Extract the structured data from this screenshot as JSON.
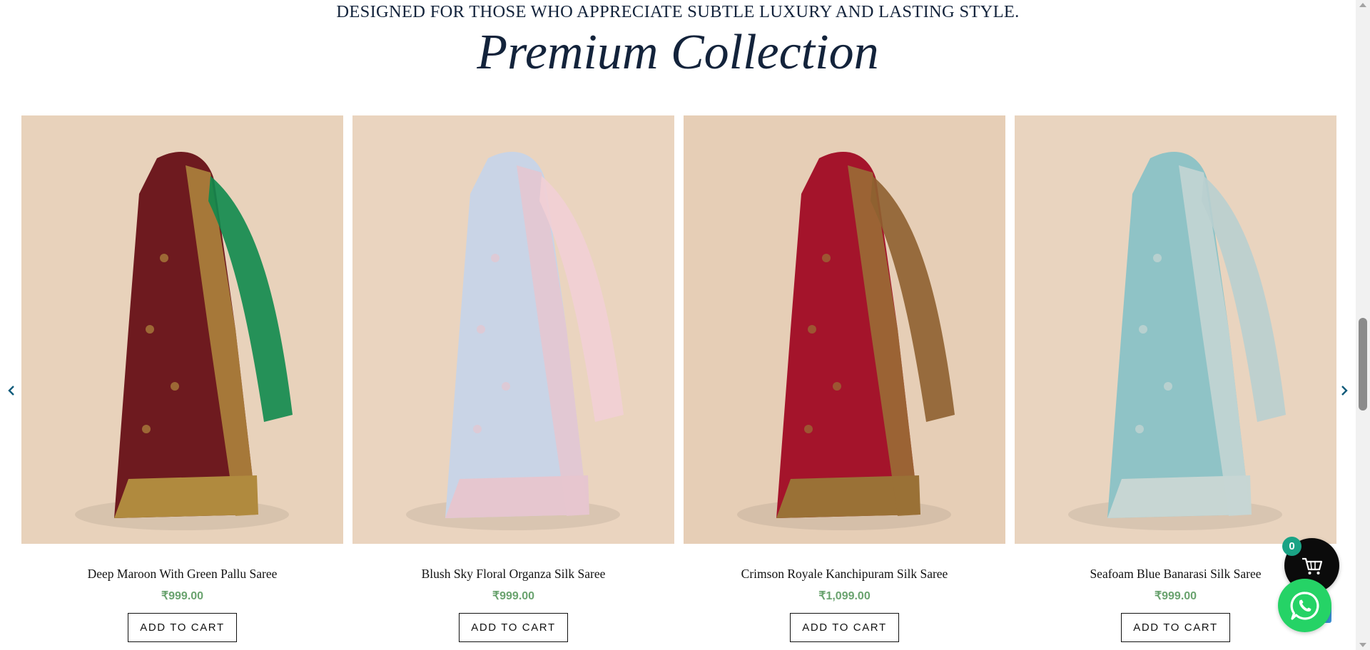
{
  "section": {
    "tagline": "DESIGNED FOR THOSE WHO APPRECIATE SUBTLE LUXURY AND LASTING STYLE.",
    "title": "Premium Collection"
  },
  "carousel": {
    "prev_icon": "chevron-left-icon",
    "next_icon": "chevron-right-icon",
    "products": [
      {
        "name": "Deep Maroon With Green Pallu Saree",
        "price": "₹999.00",
        "button": "ADD TO CART",
        "image": "saree-photo",
        "colors": {
          "bg": "#e8d2bb",
          "body": "#6e1a1f",
          "border": "#b08a3e",
          "pallu": "#0f8a4e"
        }
      },
      {
        "name": "Blush Sky Floral Organza Silk Saree",
        "price": "₹999.00",
        "button": "ADD TO CART",
        "image": "saree-photo",
        "colors": {
          "bg": "#ead4bf",
          "body": "#c9d4e6",
          "border": "#e6c6cf",
          "pallu": "#f2cfd5"
        }
      },
      {
        "name": "Crimson Royale Kanchipuram Silk Saree",
        "price": "₹1,099.00",
        "button": "ADD TO CART",
        "image": "saree-photo",
        "colors": {
          "bg": "#e6ceb6",
          "body": "#a4142b",
          "border": "#9a7136",
          "pallu": "#8e6030"
        }
      },
      {
        "name": "Seafoam Blue Banarasi Silk Saree",
        "price": "₹999.00",
        "button": "ADD TO CART",
        "image": "saree-photo",
        "colors": {
          "bg": "#e9d4bf",
          "body": "#8fc3c6",
          "border": "#c7d6d3",
          "pallu": "#b9cfcf"
        }
      }
    ]
  },
  "floating": {
    "cart_count": "0",
    "cart_icon": "shopping-cart-icon",
    "whatsapp_icon": "whatsapp-icon"
  },
  "colors": {
    "heading": "#13233b",
    "price": "#6aa36f",
    "badge": "#1aa385",
    "whatsapp": "#25d366"
  }
}
